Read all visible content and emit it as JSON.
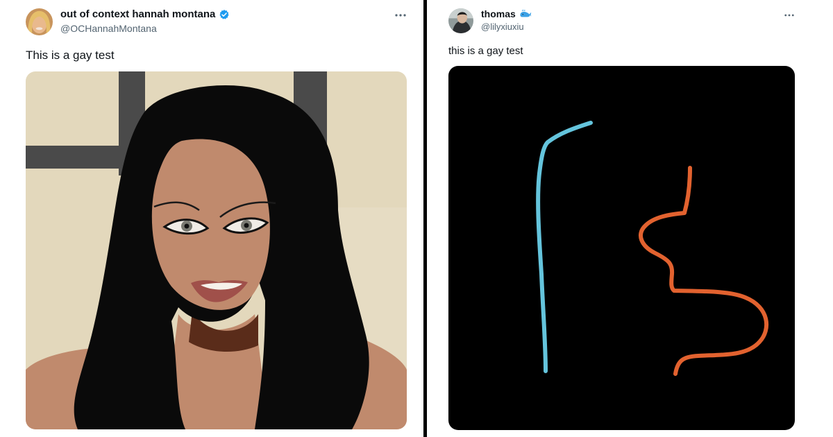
{
  "tweets": [
    {
      "author": {
        "display_name": "out of context hannah montana",
        "handle": "@OCHannahMontana",
        "badge": "verified-badge-icon",
        "badge_color": "#1d9bf0"
      },
      "text": "This is a gay test",
      "media": "digital painting of a woman with long black hair",
      "more_icon": "more-options-icon"
    },
    {
      "author": {
        "display_name": "thomas",
        "handle": "@lilyxiuxiu",
        "badge": "whale-emoji-icon",
        "badge_color": "#3ba1e6"
      },
      "text": "this is a gay test",
      "media": "black canvas with a blue line and an orange squiggle",
      "more_icon": "more-options-icon"
    }
  ],
  "colors": {
    "divider": "#000000",
    "text_primary": "#0f1419",
    "text_secondary": "#536471",
    "line_blue": "#64c4dc",
    "line_orange": "#e2622f"
  }
}
